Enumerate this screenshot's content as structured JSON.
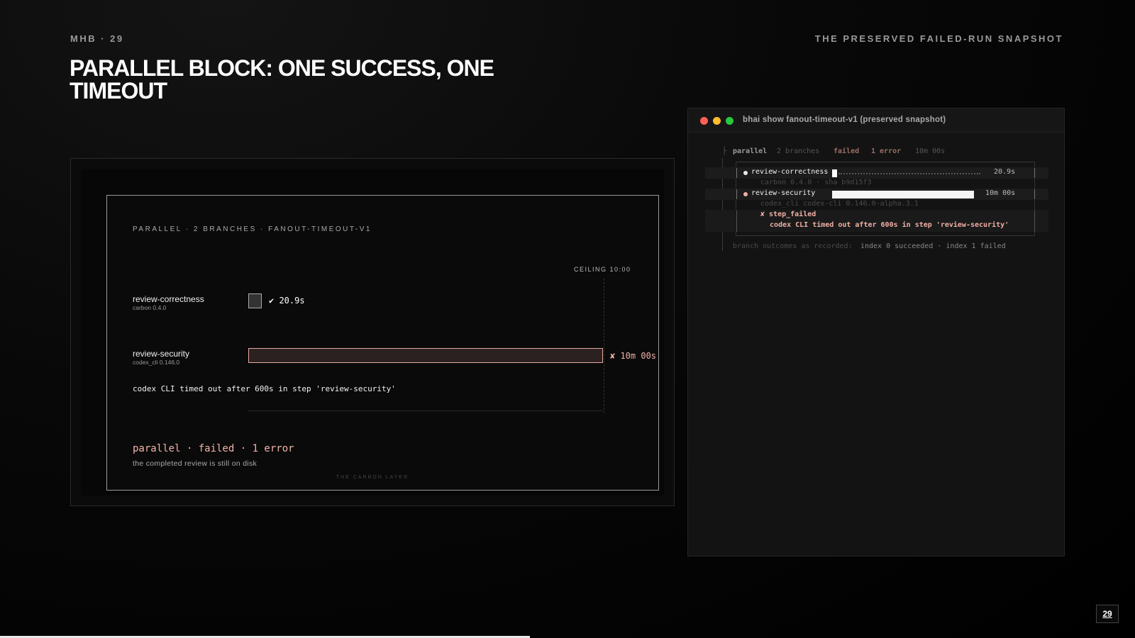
{
  "header": {
    "kicker": "MHB · 29",
    "section": "THE PRESERVED FAILED-RUN SNAPSHOT",
    "title": "PARALLEL BLOCK: ONE SUCCESS, ONE TIMEOUT"
  },
  "carbon": {
    "heading": "PARALLEL · 2 BRANCHES · FANOUT-TIMEOUT-V1",
    "ceiling": "CEILING 10:00",
    "branches": [
      {
        "name": "review-correctness",
        "sub": "carbon 0.4.0",
        "result": "✔ 20.9s",
        "duration_fraction": 0.035
      },
      {
        "name": "review-security",
        "sub": "codex_cli 0.146.0",
        "result": "✘ 10m 00s",
        "duration_fraction": 1.0
      }
    ],
    "timeout_message": "codex CLI timed out after 600s in step 'review-security'",
    "summary": "parallel · failed · 1 error",
    "summary_sub": "the completed review is still on disk",
    "caption": "THE CARBON LAYER"
  },
  "terminal": {
    "title": "bhai show fanout-timeout-v1 (preserved snapshot)",
    "colors": {
      "red": "#ff5f57",
      "yellow": "#febc2e",
      "green": "#28c840"
    },
    "header_line": {
      "label": "parallel",
      "branches": "2 branches",
      "status": "failed",
      "errors": "1 error",
      "duration": "10m 00s"
    },
    "rows": [
      {
        "name": "review-correctness",
        "time": "20.9s",
        "sub": "carbon 0.4.0 · sha b9d15f3",
        "fill_fraction": 0.03
      },
      {
        "name": "review-security",
        "time": "10m 00s",
        "sub": "codex_cli codex-cli 0.146.0-alpha.3.1",
        "fill_fraction": 0.98
      }
    ],
    "error_label": "✘ step_failed",
    "error_message": "codex CLI timed out after 600s in step 'review-security'",
    "outcome_label": "branch outcomes as recorded:",
    "outcome_value": "index 0 succeeded · index 1 failed"
  },
  "page": {
    "number": "29"
  }
}
